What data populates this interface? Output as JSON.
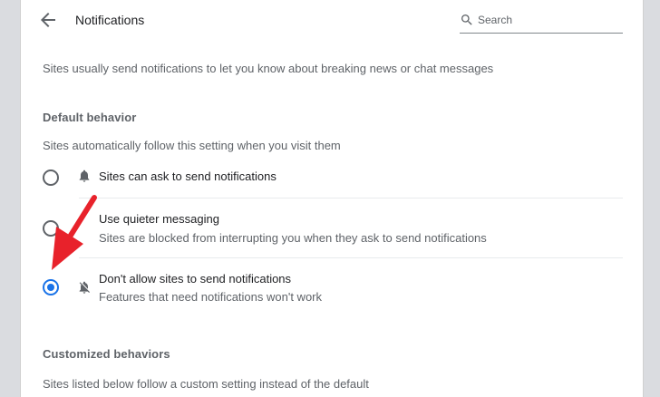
{
  "header": {
    "title": "Notifications",
    "search_placeholder": "Search"
  },
  "intro": "Sites usually send notifications to let you know about breaking news or chat messages",
  "default_behavior": {
    "title": "Default behavior",
    "description": "Sites automatically follow this setting when you visit them",
    "options": [
      {
        "label": "Sites can ask to send notifications",
        "sublabel": "",
        "icon": "bell-icon",
        "checked": false
      },
      {
        "label": "Use quieter messaging",
        "sublabel": "Sites are blocked from interrupting you when they ask to send notifications",
        "icon": "",
        "checked": false
      },
      {
        "label": "Don't allow sites to send notifications",
        "sublabel": "Features that need notifications won't work",
        "icon": "bell-off-icon",
        "checked": true
      }
    ]
  },
  "customized": {
    "title": "Customized behaviors",
    "description": "Sites listed below follow a custom setting instead of the default"
  },
  "colors": {
    "accent": "#1a73e8",
    "annotation_arrow": "#e8222b"
  }
}
